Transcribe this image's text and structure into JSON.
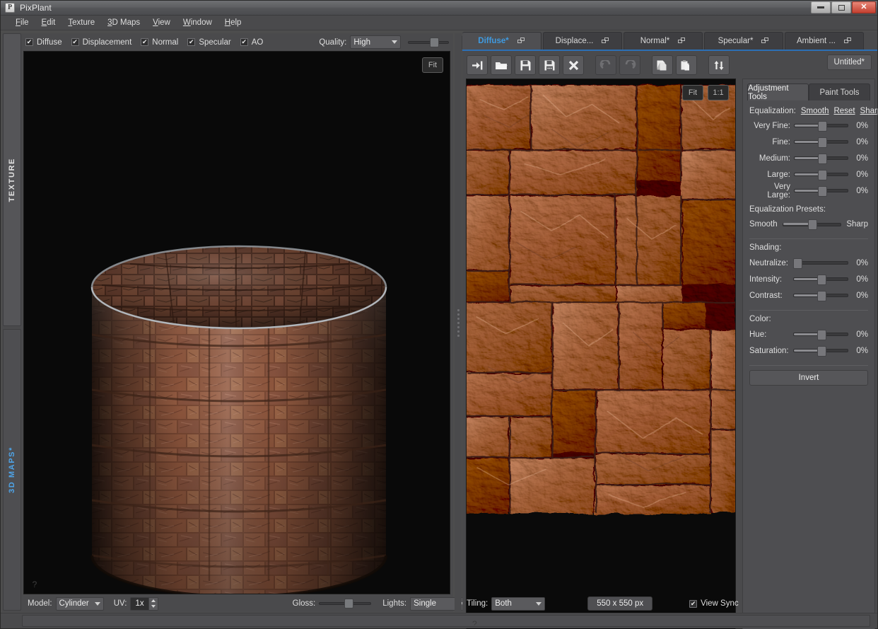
{
  "window": {
    "title": "PixPlant",
    "logo_letter": "P",
    "controls": {
      "minimize": "minimize-button",
      "maximize": "maximize-button",
      "close": "✕"
    }
  },
  "menubar": {
    "items": [
      {
        "label": "File",
        "accel": "F"
      },
      {
        "label": "Edit",
        "accel": "E"
      },
      {
        "label": "Texture",
        "accel": "T"
      },
      {
        "label": "3D Maps",
        "accel": "3"
      },
      {
        "label": "View",
        "accel": "V"
      },
      {
        "label": "Window",
        "accel": "W"
      },
      {
        "label": "Help",
        "accel": "H"
      }
    ]
  },
  "vertical_tabs": [
    {
      "label": "TEXTURE",
      "active": false,
      "color": "#e2e2e2"
    },
    {
      "label": "3D MAPS*",
      "active": true,
      "color": "#4ea4e8"
    }
  ],
  "left_panel": {
    "channels": [
      {
        "label": "Diffuse",
        "checked": true
      },
      {
        "label": "Displacement",
        "checked": true
      },
      {
        "label": "Normal",
        "checked": true
      },
      {
        "label": "Specular",
        "checked": true
      },
      {
        "label": "AO",
        "checked": true
      }
    ],
    "quality_label": "Quality:",
    "quality_value": "High",
    "quality_slider_pct": 52,
    "popout_icon": "popout-icon",
    "viewport": {
      "fit_label": "Fit",
      "help_label": "?",
      "model_preview": "3d-cylinder-stone-preview"
    },
    "bottom": {
      "model_label": "Model:",
      "model_value": "Cylinder",
      "uv_label": "UV:",
      "uv_value": "1x",
      "gloss_label": "Gloss:",
      "gloss_pct": 48,
      "lights_label": "Lights:",
      "lights_value": "Single"
    }
  },
  "right_panel": {
    "map_tabs": [
      {
        "label": "Diffuse*",
        "active": true
      },
      {
        "label": "Displace...",
        "active": false
      },
      {
        "label": "Normal*",
        "active": false
      },
      {
        "label": "Specular*",
        "active": false
      },
      {
        "label": "Ambient ...",
        "active": false
      }
    ],
    "toolbar": [
      {
        "name": "import-button",
        "icon": "arrow-to-bar-icon",
        "disabled": false
      },
      {
        "name": "open-button",
        "icon": "folder-open-icon",
        "disabled": false
      },
      {
        "name": "save-button",
        "icon": "floppy-save-icon",
        "disabled": false
      },
      {
        "name": "save-as-button",
        "icon": "floppy-save-as-icon",
        "disabled": false
      },
      {
        "name": "close-button",
        "icon": "close-x-icon",
        "disabled": false
      },
      {
        "name": "undo-button",
        "icon": "undo-arrow-icon",
        "disabled": true
      },
      {
        "name": "redo-button",
        "icon": "redo-arrow-icon",
        "disabled": true
      },
      {
        "name": "copy-button",
        "icon": "copy-icon",
        "disabled": false
      },
      {
        "name": "paste-button",
        "icon": "paste-icon",
        "disabled": false
      },
      {
        "name": "swap-button",
        "icon": "up-down-arrows-icon",
        "disabled": false
      }
    ],
    "file_name": "Untitled*",
    "texture_viewport": {
      "fit_label": "Fit",
      "one_to_one_label": "1:1",
      "help_label": "?",
      "texture_preview": "stone-block-tiling-texture"
    },
    "adjustment": {
      "tabs": [
        {
          "label": "Adjustment Tools",
          "active": true
        },
        {
          "label": "Paint Tools",
          "active": false
        }
      ],
      "equalization_label": "Equalization:",
      "equalization_links": [
        "Smooth",
        "Reset",
        "Sharp"
      ],
      "equalization_sliders": [
        {
          "label": "Very Fine:",
          "value": "0%",
          "pct": 50
        },
        {
          "label": "Fine:",
          "value": "0%",
          "pct": 50
        },
        {
          "label": "Medium:",
          "value": "0%",
          "pct": 50
        },
        {
          "label": "Large:",
          "value": "0%",
          "pct": 50
        },
        {
          "label": "Very Large:",
          "value": "0%",
          "pct": 50
        }
      ],
      "presets_label": "Equalization Presets:",
      "preset_min": "Smooth",
      "preset_max": "Sharp",
      "preset_pct": 50,
      "shading_label": "Shading:",
      "shading_sliders": [
        {
          "label": "Neutralize:",
          "value": "0%",
          "pct": 0
        },
        {
          "label": "Intensity:",
          "value": "0%",
          "pct": 50
        },
        {
          "label": "Contrast:",
          "value": "0%",
          "pct": 50
        }
      ],
      "color_label": "Color:",
      "color_sliders": [
        {
          "label": "Hue:",
          "value": "0%",
          "pct": 50
        },
        {
          "label": "Saturation:",
          "value": "0%",
          "pct": 50
        }
      ],
      "invert_label": "Invert"
    },
    "bottom": {
      "tiling_label": "Tiling:",
      "tiling_value": "Both",
      "size_label": "550 x 550 px",
      "view_sync_label": "View Sync",
      "view_sync_checked": true
    }
  },
  "theme": {
    "bg": "#4a4a4c",
    "panel": "#4e4e51",
    "accent_blue": "#3f9ae0",
    "tab_underline": "#2c6fb5",
    "text": "#dedede",
    "viewport_bg": "#0a0a0a",
    "stone_base": "#b5785c",
    "stone_dark": "#5a3326"
  }
}
